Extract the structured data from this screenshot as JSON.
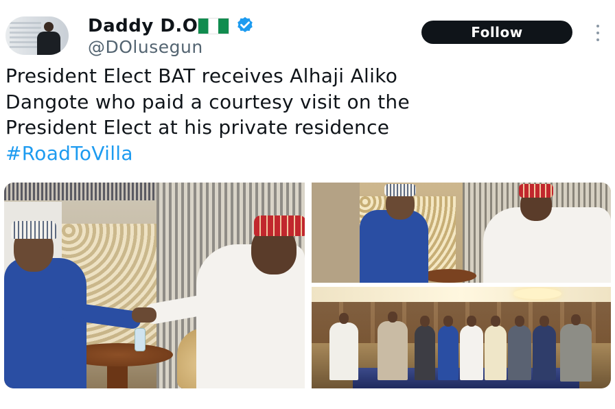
{
  "tweet": {
    "display_name": "Daddy D.O",
    "handle": "@DOlusegun",
    "follow_label": "Follow",
    "text_lines": [
      "President Elect BAT receives Alhaji Aliko",
      "Dangote who paid a courtesy visit on the",
      "President Elect at his private residence"
    ],
    "hashtag": "#RoadToVilla"
  },
  "icons": {
    "flag": "nigeria-flag-icon",
    "verified": "verified-badge-icon",
    "more": "more-options-icon"
  },
  "colors": {
    "text": "#0f1419",
    "muted": "#536471",
    "link": "#1d9bf0",
    "follow_bg": "#0f1419",
    "verified": "#1d9bf0",
    "flag_green": "#118c4f"
  }
}
